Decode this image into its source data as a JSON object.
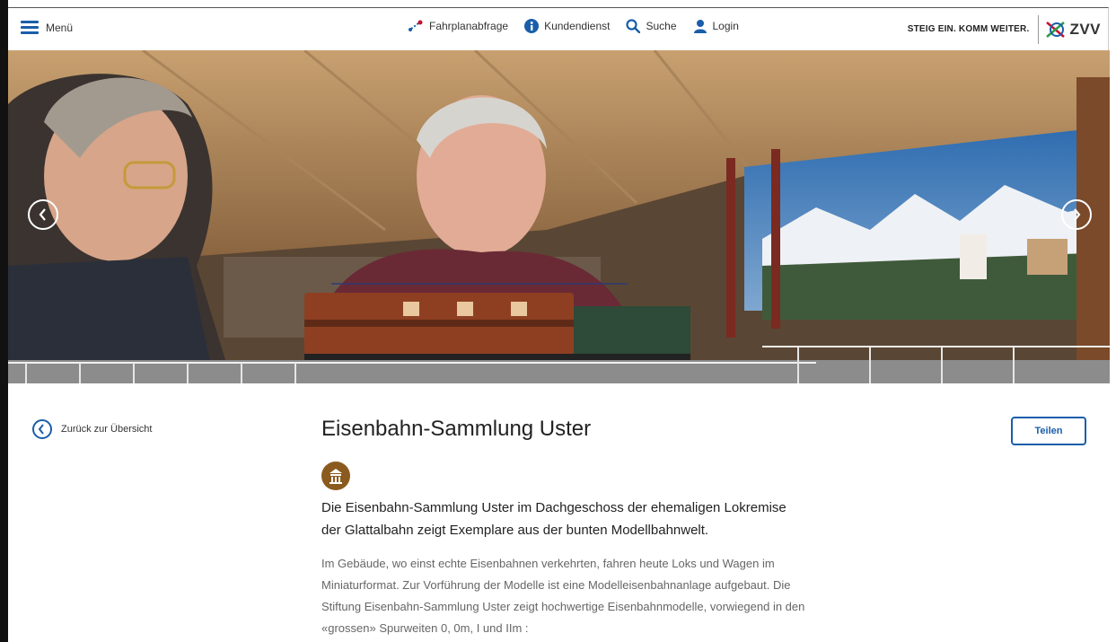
{
  "header": {
    "menu_label": "Menü",
    "nav": [
      {
        "label": "Fahrplanabfrage",
        "icon": "route-icon"
      },
      {
        "label": "Kundendienst",
        "icon": "info-icon"
      },
      {
        "label": "Suche",
        "icon": "search-icon"
      },
      {
        "label": "Login",
        "icon": "user-icon"
      }
    ],
    "slogan": "STEIG EIN. KOMM WEITER.",
    "logo_text": "ZVV"
  },
  "hero": {
    "prev_icon": "chevron-left-icon",
    "next_icon": "chevron-right-icon"
  },
  "content": {
    "back_label": "Zurück zur Übersicht",
    "title": "Eisenbahn-Sammlung Uster",
    "category_icon": "museum-icon",
    "lead": "Die Eisenbahn-Sammlung Uster im Dachgeschoss der ehemaligen Lokremise der Glattalbahn zeigt Exemplare aus der bunten Modellbahnwelt.",
    "body": "Im Gebäude, wo einst echte Eisenbahnen verkehrten, fahren heute Loks und Wagen im Miniaturformat. Zur Vorführung der Modelle ist eine Modelleisenbahnanlage aufgebaut. Die Stiftung Eisenbahn-Sammlung Uster zeigt hochwertige Eisenbahnmodelle, vorwiegend in den «grossen» Spurweiten 0, 0m, I und IIm :",
    "share_label": "Teilen"
  },
  "colors": {
    "accent": "#1a5ea9",
    "category": "#8a5a1e"
  }
}
